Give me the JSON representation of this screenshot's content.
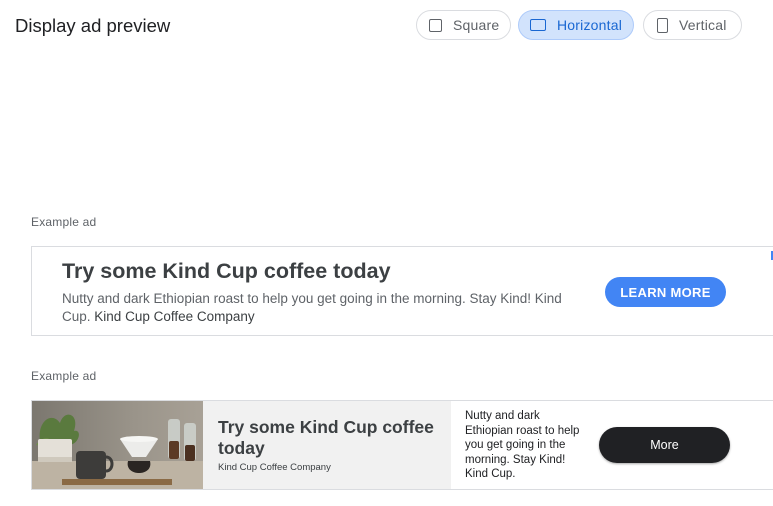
{
  "header": {
    "title": "Display ad preview",
    "formats": [
      {
        "label": "Square",
        "icon": "square-icon",
        "selected": false
      },
      {
        "label": "Horizontal",
        "icon": "horizontal-rectangle-icon",
        "selected": true
      },
      {
        "label": "Vertical",
        "icon": "vertical-rectangle-icon",
        "selected": false
      }
    ]
  },
  "ads": [
    {
      "label": "Example ad",
      "headline": "Try some Kind Cup coffee today",
      "description": "Nutty and dark Ethiopian roast to help you get going in the morning. Stay Kind! Kind Cup.",
      "company": "Kind Cup Coffee Company",
      "cta": "LEARN MORE",
      "cta_color": "#4285f4"
    },
    {
      "label": "Example ad",
      "headline": "Try some Kind Cup coffee today",
      "company": "Kind Cup Coffee Company",
      "description": "Nutty and dark Ethiopian roast to help you get going in the morning. Stay Kind! Kind Cup.",
      "cta": "More",
      "cta_color": "#202124",
      "image": "coffee-pour-over-photo"
    }
  ],
  "colors": {
    "selected_chip_bg": "#d2e3fc",
    "selected_chip_text": "#1967d2",
    "border": "#dadce0"
  }
}
